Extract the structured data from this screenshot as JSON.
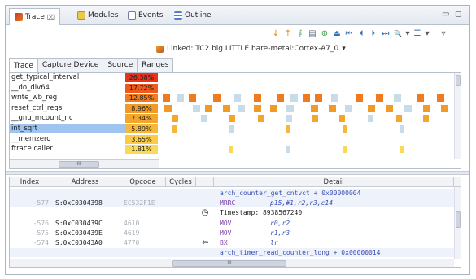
{
  "tabs": [
    {
      "label": "Trace",
      "icon": "trace-icon",
      "close": "⌧"
    },
    {
      "label": "Modules",
      "icon": "modules-icon"
    },
    {
      "label": "Events",
      "icon": "events-icon"
    },
    {
      "label": "Outline",
      "icon": "outline-icon"
    }
  ],
  "window_controls": {
    "minimize": "▭",
    "maximize": "◻"
  },
  "toolbar": {
    "buttons": [
      "↓",
      "↑",
      "∮",
      "▤",
      "⊕",
      "⏏",
      "⏮",
      "⏴",
      "⏵",
      "⏭",
      "🔍",
      "▾",
      "☰",
      "▾"
    ],
    "menu": "▿"
  },
  "linked": {
    "text": "Linked: TC2 big.LITTLE bare-metal:Cortex-A7_0",
    "arrow": "▾"
  },
  "inner_tabs": [
    "Trace",
    "Capture Device",
    "Source",
    "Ranges"
  ],
  "functions": [
    {
      "name": "get_typical_interval",
      "pct": "26.38%",
      "color": "#e8321c"
    },
    {
      "name": "__do_div64",
      "pct": "17.72%",
      "color": "#ec5a1e"
    },
    {
      "name": "write_wb_reg",
      "pct": "12.85%",
      "color": "#ef7a20"
    },
    {
      "name": "reset_ctrl_regs",
      "pct": "8.96%",
      "color": "#f29a26"
    },
    {
      "name": "__gnu_mcount_nc",
      "pct": "7.34%",
      "color": "#f4a52c"
    },
    {
      "name": "int_sqrt",
      "pct": "5.89%",
      "color": "#f7b83a"
    },
    {
      "name": "__memzero",
      "pct": "3.65%",
      "color": "#f9cb48"
    },
    {
      "name": "ftrace caller",
      "pct": "1.81%",
      "color": "#fbd958"
    }
  ],
  "scroll_grip": "III",
  "columns": [
    "Index",
    "Address",
    "Opcode",
    "Cycles",
    "",
    "Detail"
  ],
  "rows": [
    {
      "index": "",
      "address": "",
      "opcode": "",
      "cycles": "",
      "icon": "",
      "detail": "arch_counter_get_cntvct + 0x00000004",
      "args": ""
    },
    {
      "index": "-577",
      "address": "S:0xC0304398",
      "opcode": "EC532F1E",
      "cycles": "",
      "icon": "",
      "detail": "MRRC",
      "args": "p15,#1,r2,r3,c14"
    },
    {
      "index": "",
      "address": "",
      "opcode": "",
      "cycles": "",
      "icon": "clock",
      "detail": "Timestamp: 8938567240",
      "args": ""
    },
    {
      "index": "-576",
      "address": "S:0xC030439C",
      "opcode": "4610",
      "cycles": "",
      "icon": "",
      "detail": "MOV",
      "args": "r0,r2"
    },
    {
      "index": "-575",
      "address": "S:0xC030439E",
      "opcode": "4619",
      "cycles": "",
      "icon": "",
      "detail": "MOV",
      "args": "r1,r3"
    },
    {
      "index": "-574",
      "address": "S:0xC03043A0",
      "opcode": "4770",
      "cycles": "",
      "icon": "branch",
      "detail": "BX",
      "args": "lr"
    },
    {
      "index": "",
      "address": "",
      "opcode": "",
      "cycles": "",
      "icon": "",
      "detail": "arch_timer_read_counter_long + 0x00000014",
      "args": ""
    }
  ],
  "glyphs": {
    "clock": "◷",
    "branch": "⇦",
    "dash": "—"
  }
}
